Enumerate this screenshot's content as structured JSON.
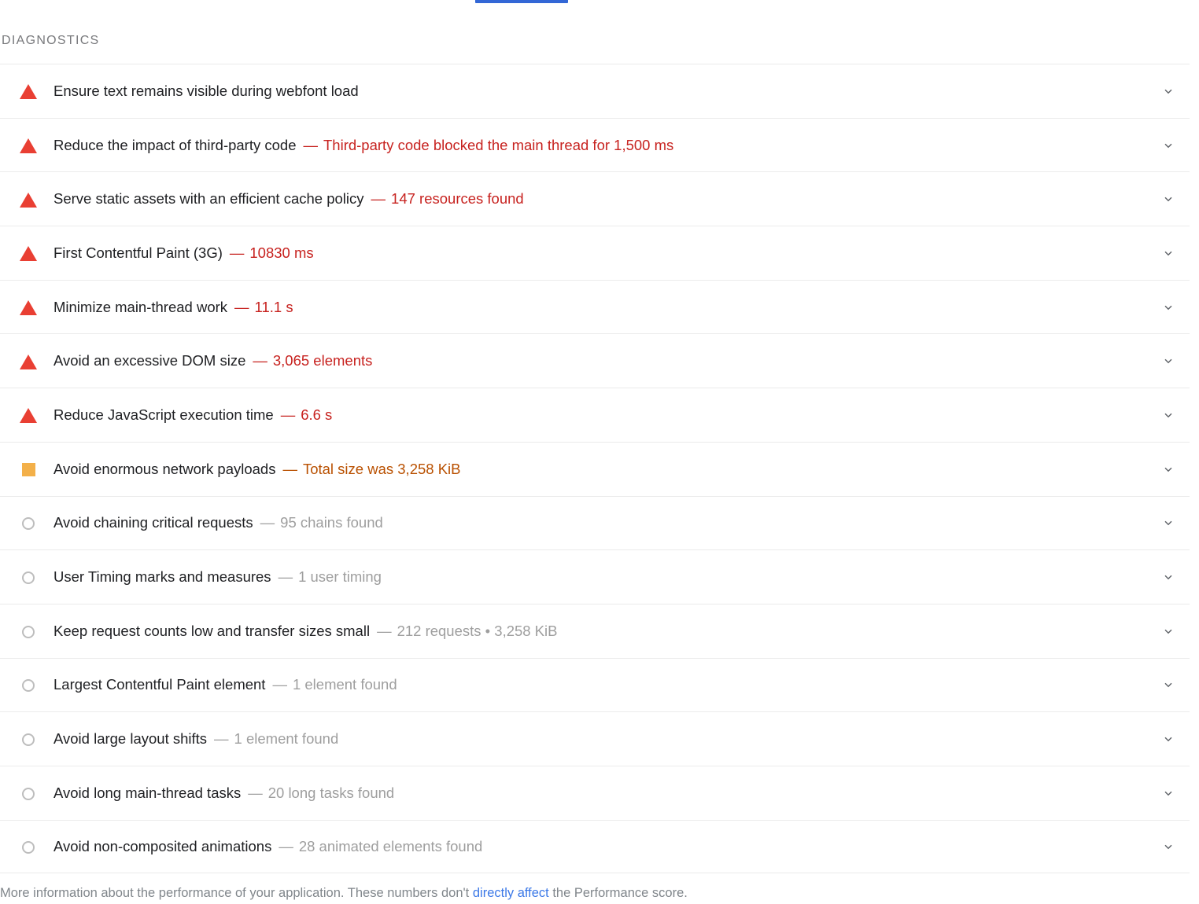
{
  "section": {
    "header_label": "DIAGNOSTICS"
  },
  "colors": {
    "fail": "#c7221f",
    "average": "#b95000",
    "info": "#9e9e9e",
    "fail_icon": "#e93f33",
    "average_icon": "#f3b049",
    "info_icon": "#bdbdbd",
    "link": "#3b78e7",
    "tab_accent": "#3367d6"
  },
  "audits": [
    {
      "severity": "fail",
      "icon": "triangle-warning-icon",
      "title": "Ensure text remains visible during webfont load",
      "dash": "",
      "value": "",
      "expand_icon": "chevron-down-icon"
    },
    {
      "severity": "fail",
      "icon": "triangle-warning-icon",
      "title": "Reduce the impact of third-party code",
      "dash": "—",
      "value": "Third-party code blocked the main thread for 1,500 ms",
      "expand_icon": "chevron-down-icon"
    },
    {
      "severity": "fail",
      "icon": "triangle-warning-icon",
      "title": "Serve static assets with an efficient cache policy",
      "dash": "—",
      "value": "147 resources found",
      "expand_icon": "chevron-down-icon"
    },
    {
      "severity": "fail",
      "icon": "triangle-warning-icon",
      "title": "First Contentful Paint (3G)",
      "dash": "—",
      "value": "10830 ms",
      "expand_icon": "chevron-down-icon"
    },
    {
      "severity": "fail",
      "icon": "triangle-warning-icon",
      "title": "Minimize main-thread work",
      "dash": "—",
      "value": "11.1 s",
      "expand_icon": "chevron-down-icon"
    },
    {
      "severity": "fail",
      "icon": "triangle-warning-icon",
      "title": "Avoid an excessive DOM size",
      "dash": "—",
      "value": "3,065 elements",
      "expand_icon": "chevron-down-icon"
    },
    {
      "severity": "fail",
      "icon": "triangle-warning-icon",
      "title": "Reduce JavaScript execution time",
      "dash": "—",
      "value": "6.6 s",
      "expand_icon": "chevron-down-icon"
    },
    {
      "severity": "average",
      "icon": "square-average-icon",
      "title": "Avoid enormous network payloads",
      "dash": "—",
      "value": "Total size was 3,258 KiB",
      "expand_icon": "chevron-down-icon"
    },
    {
      "severity": "info",
      "icon": "circle-info-icon",
      "title": "Avoid chaining critical requests",
      "dash": "—",
      "value": "95 chains found",
      "expand_icon": "chevron-down-icon"
    },
    {
      "severity": "info",
      "icon": "circle-info-icon",
      "title": "User Timing marks and measures",
      "dash": "—",
      "value": "1 user timing",
      "expand_icon": "chevron-down-icon"
    },
    {
      "severity": "info",
      "icon": "circle-info-icon",
      "title": "Keep request counts low and transfer sizes small",
      "dash": "—",
      "value": "212 requests • 3,258 KiB",
      "expand_icon": "chevron-down-icon"
    },
    {
      "severity": "info",
      "icon": "circle-info-icon",
      "title": "Largest Contentful Paint element",
      "dash": "—",
      "value": "1 element found",
      "expand_icon": "chevron-down-icon"
    },
    {
      "severity": "info",
      "icon": "circle-info-icon",
      "title": "Avoid large layout shifts",
      "dash": "—",
      "value": "1 element found",
      "expand_icon": "chevron-down-icon"
    },
    {
      "severity": "info",
      "icon": "circle-info-icon",
      "title": "Avoid long main-thread tasks",
      "dash": "—",
      "value": "20 long tasks found",
      "expand_icon": "chevron-down-icon"
    },
    {
      "severity": "info",
      "icon": "circle-info-icon",
      "title": "Avoid non-composited animations",
      "dash": "—",
      "value": "28 animated elements found",
      "expand_icon": "chevron-down-icon"
    }
  ],
  "footer": {
    "text_before_link": "More information about the performance of your application. These numbers don't ",
    "link_text": "directly affect",
    "text_after_link": " the Performance score."
  }
}
